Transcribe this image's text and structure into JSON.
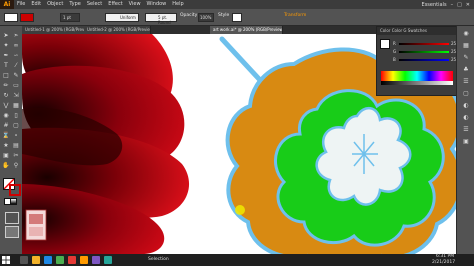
{
  "app": {
    "logo": "Ai",
    "workspace": "Essentials"
  },
  "menu": [
    "File",
    "Edit",
    "Object",
    "Type",
    "Select",
    "Effect",
    "View",
    "Window",
    "Help"
  ],
  "control_bar": {
    "stroke_width": "1 pt",
    "stroke_style": "Uniform",
    "brush": "5 pt. Round",
    "opacity_label": "Opacity",
    "opacity_value": "100%",
    "style_label": "Style",
    "transform_label": "Transform"
  },
  "tabs": [
    {
      "label": "Untitled-1 @ 200% (RGB/Preview)"
    },
    {
      "label": "Untitled-2 @ 200% (RGB/Preview)"
    },
    {
      "label": "art work.ai* @ 200% (RGB/Preview)"
    }
  ],
  "color_panel": {
    "tabs": "Color  Color G  Swatches",
    "r_label": "R",
    "g_label": "G",
    "b_label": "B",
    "r_value": "255",
    "g_value": "255",
    "b_value": "255"
  },
  "status": {
    "selection_label": "Selection",
    "time": "6:31 PM",
    "date": "2/21/2017"
  },
  "colors": {
    "ui_dark": "#323232",
    "ui_mid": "#535353",
    "flower_red": "#c0000f",
    "flower_orange": "#d88a12",
    "flower_green": "#18cc18",
    "flower_blue_outline": "#6ec0ec",
    "flower_center": "#eef4f4",
    "ai_orange": "#ff9a00"
  }
}
